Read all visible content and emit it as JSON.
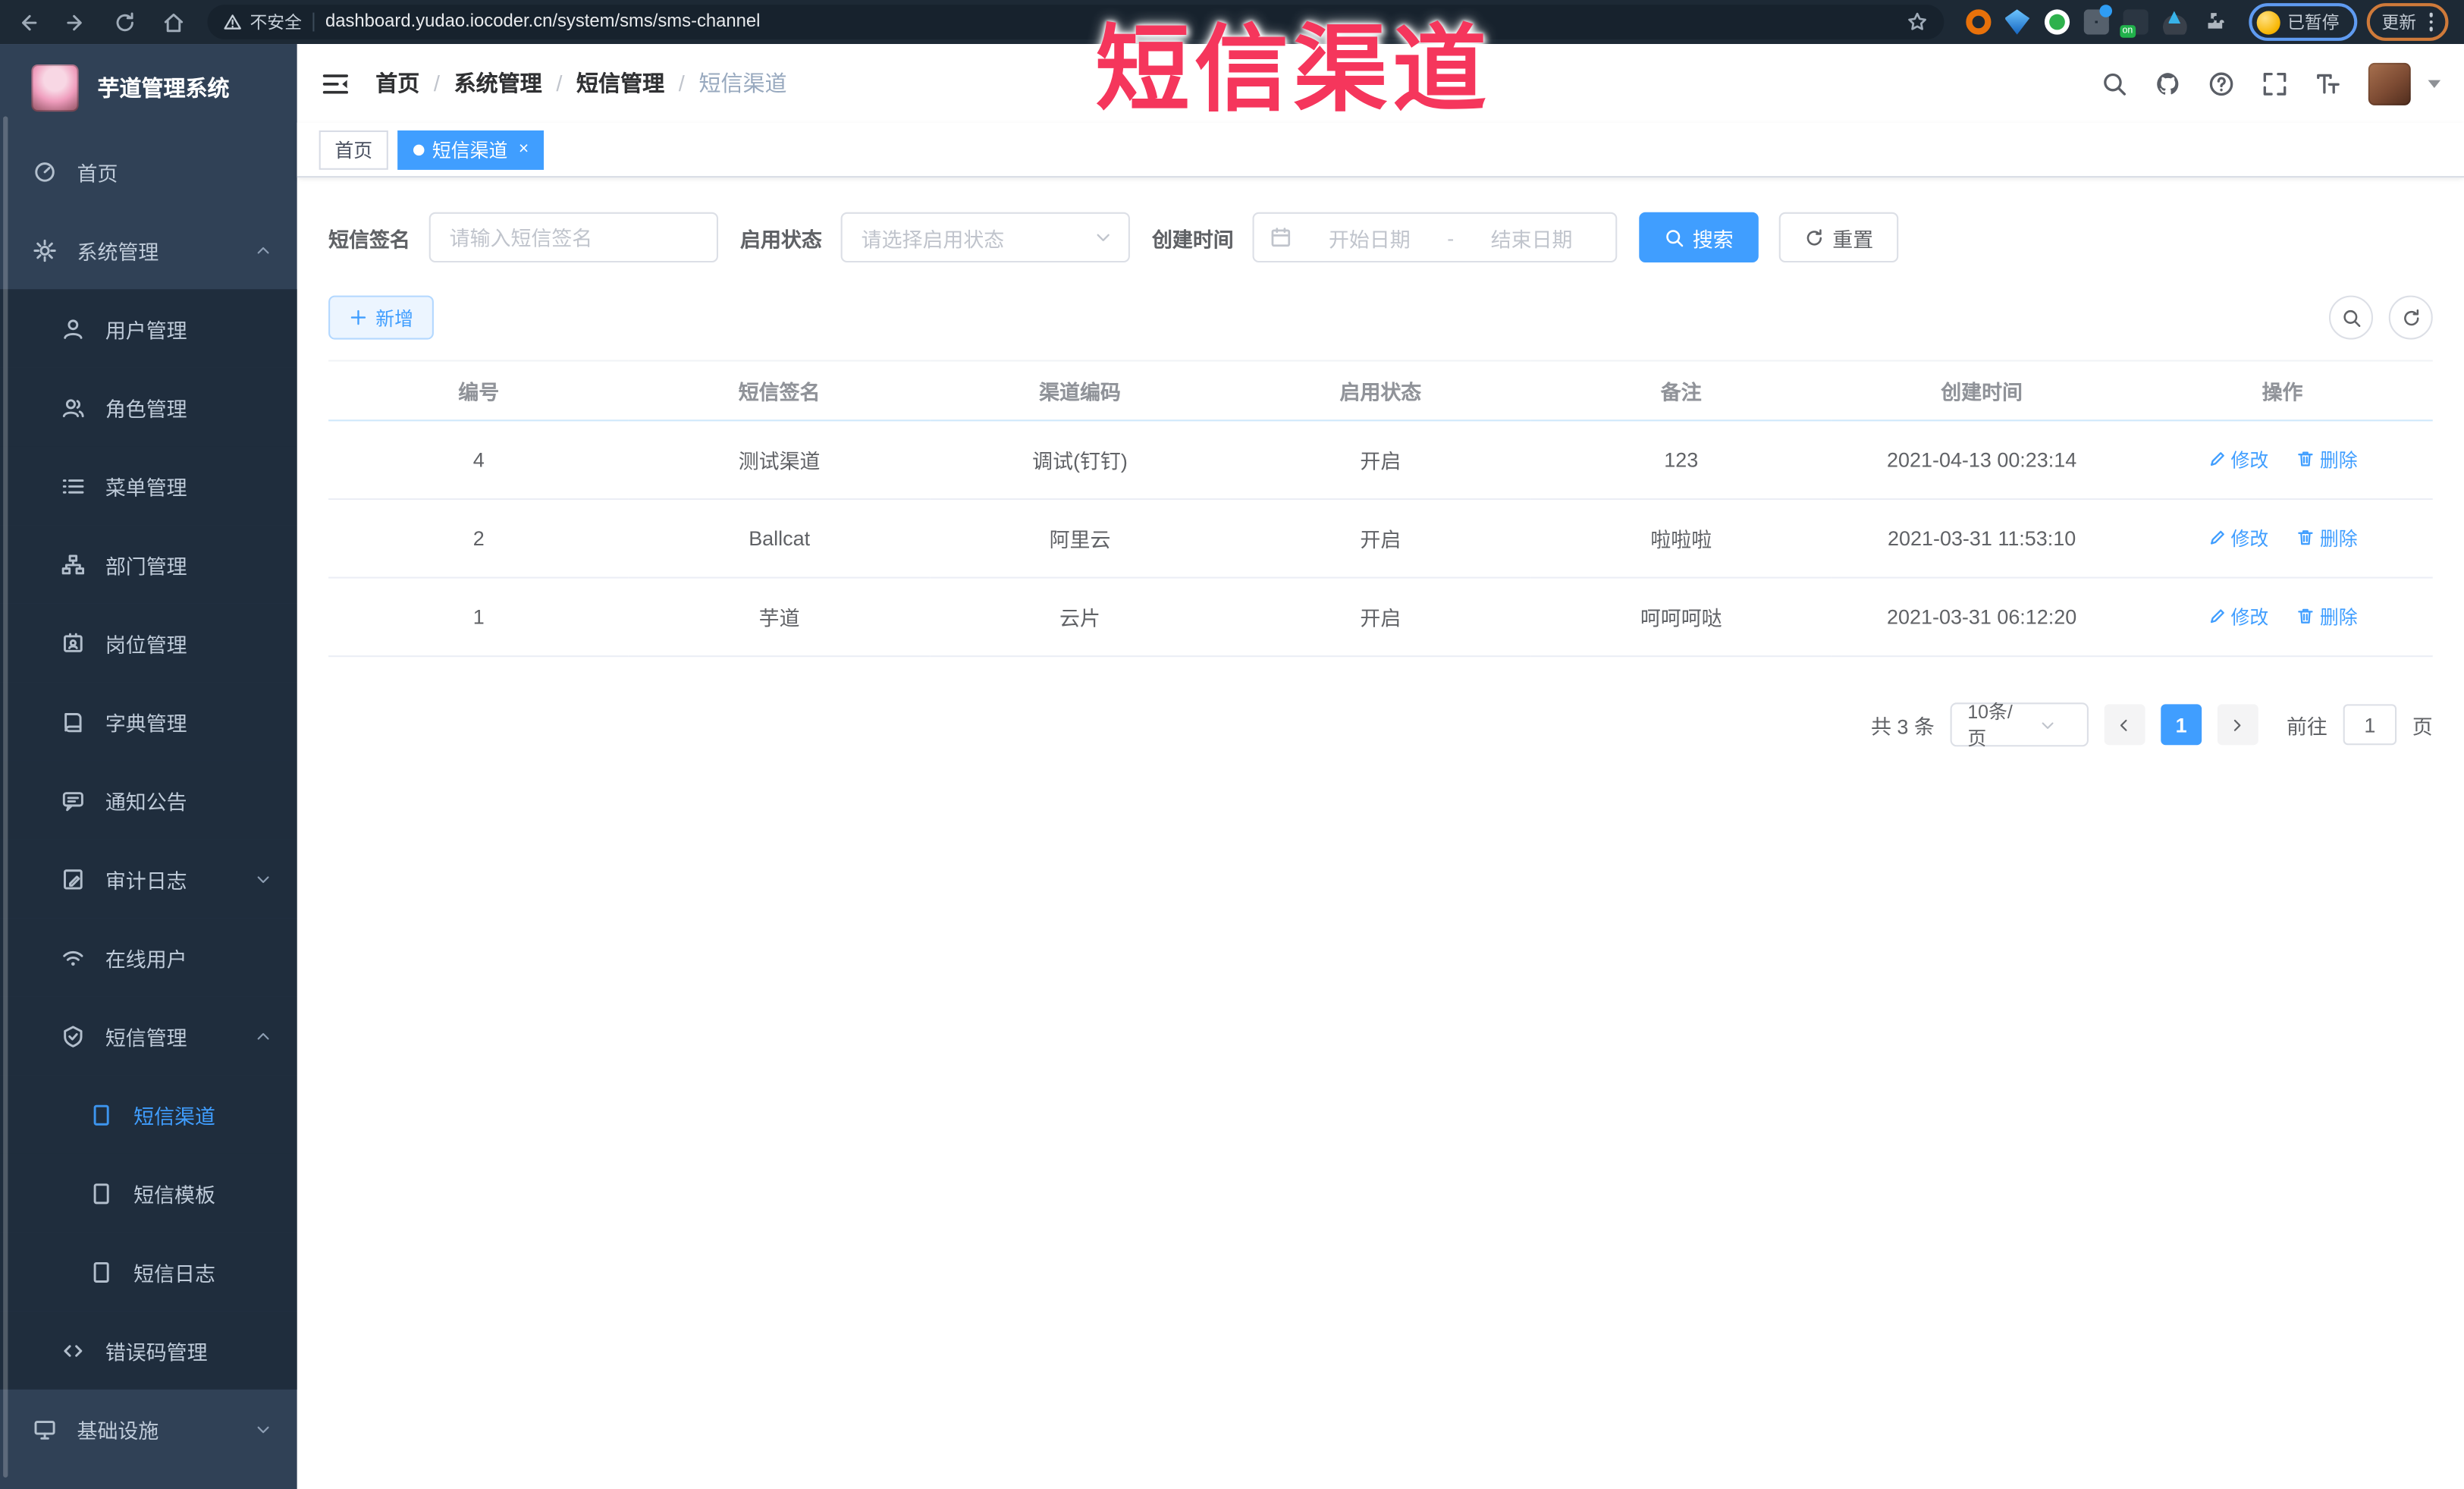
{
  "colors": {
    "accent": "#409eff",
    "sidebar_bg": "#304156",
    "submenu_bg": "#1f2d3d",
    "browser_bg": "#1d2935",
    "annotation": "#f5365c",
    "tag_active": "#409eff"
  },
  "browser": {
    "security_warning": "不安全",
    "url": "dashboard.yudao.iocoder.cn/system/sms/sms-channel",
    "paused_badge": "已暂停",
    "update_badge": "更新"
  },
  "annotation": {
    "text": "短信渠道"
  },
  "sidebar": {
    "logo_title": "芋道管理系统",
    "items": [
      {
        "label": "首页"
      },
      {
        "label": "系统管理"
      },
      {
        "label": "用户管理"
      },
      {
        "label": "角色管理"
      },
      {
        "label": "菜单管理"
      },
      {
        "label": "部门管理"
      },
      {
        "label": "岗位管理"
      },
      {
        "label": "字典管理"
      },
      {
        "label": "通知公告"
      },
      {
        "label": "审计日志"
      },
      {
        "label": "在线用户"
      },
      {
        "label": "短信管理"
      },
      {
        "label": "短信渠道"
      },
      {
        "label": "短信模板"
      },
      {
        "label": "短信日志"
      },
      {
        "label": "错误码管理"
      },
      {
        "label": "基础设施"
      }
    ]
  },
  "header": {
    "breadcrumb": [
      "首页",
      "系统管理",
      "短信管理",
      "短信渠道"
    ]
  },
  "tabs": [
    {
      "label": "首页"
    },
    {
      "label": "短信渠道",
      "close": "×"
    }
  ],
  "filters": {
    "signature_label": "短信签名",
    "signature_placeholder": "请输入短信签名",
    "status_label": "启用状态",
    "status_placeholder": "请选择启用状态",
    "time_label": "创建时间",
    "start_placeholder": "开始日期",
    "separator": "-",
    "end_placeholder": "结束日期",
    "search_label": "搜索",
    "reset_label": "重置"
  },
  "toolbar": {
    "add_label": "新增"
  },
  "table": {
    "columns": [
      "编号",
      "短信签名",
      "渠道编码",
      "启用状态",
      "备注",
      "创建时间",
      "操作"
    ],
    "edit_label": "修改",
    "delete_label": "删除",
    "rows": [
      {
        "id": "4",
        "signature": "测试渠道",
        "code": "调试(钉钉)",
        "status": "开启",
        "remark": "123",
        "created": "2021-04-13 00:23:14"
      },
      {
        "id": "2",
        "signature": "Ballcat",
        "code": "阿里云",
        "status": "开启",
        "remark": "啦啦啦",
        "created": "2021-03-31 11:53:10"
      },
      {
        "id": "1",
        "signature": "芋道",
        "code": "云片",
        "status": "开启",
        "remark": "呵呵呵哒",
        "created": "2021-03-31 06:12:20"
      }
    ]
  },
  "pagination": {
    "total_text": "共 3 条",
    "page_size": "10条/页",
    "current_page": "1",
    "goto_label": "前往",
    "goto_value": "1",
    "page_label": "页"
  }
}
